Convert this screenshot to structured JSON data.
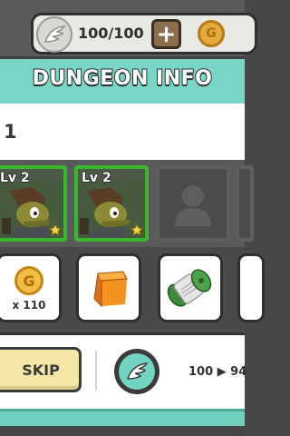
{
  "topbar": {
    "energy": "100/100",
    "plus_label": "+",
    "gold_symbol": "G"
  },
  "panel": {
    "title": "DUNGEON INFO",
    "level": "1"
  },
  "heroes": [
    {
      "level_label": "Lv 2"
    },
    {
      "level_label": "Lv 2"
    }
  ],
  "rewards": {
    "gold": {
      "symbol": "G",
      "quantity": "x 110"
    }
  },
  "actions": {
    "skip_label": "SKIP",
    "energy_change": "100 ▶ 94"
  },
  "colors": {
    "header_teal": "#79d6c6",
    "hero_border_green": "#37b82f",
    "skip_yellow": "#f4e7a8",
    "gold": "#f0bd45"
  },
  "icons": [
    "wing-icon",
    "plus-icon",
    "gold-coin-icon",
    "star-icon",
    "empty-hero-icon",
    "orange-cube-icon",
    "thread-spool-icon"
  ]
}
